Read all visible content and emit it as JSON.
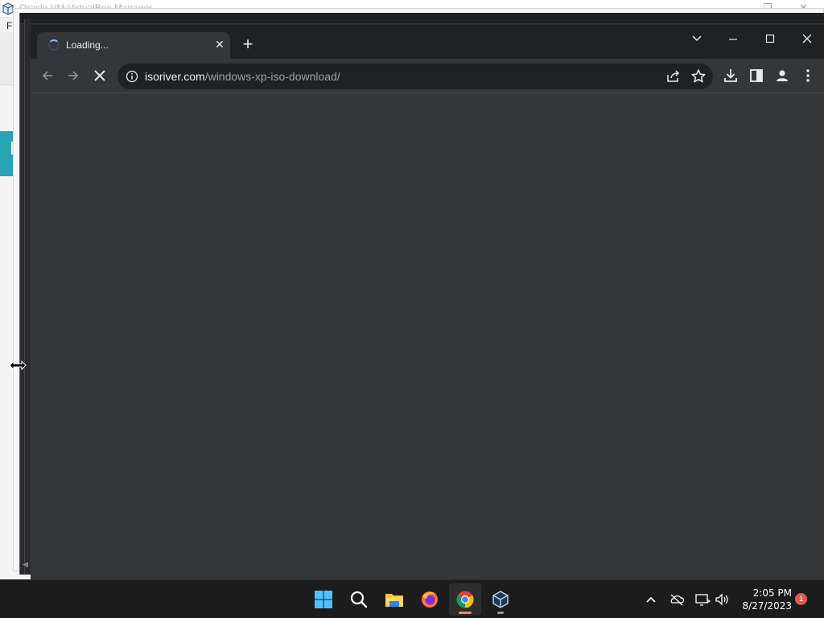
{
  "background_window": {
    "title": "Oracle VM VirtualBox Manager",
    "menu_first_letter": "Fi",
    "accent_color": "#2aa3b5"
  },
  "browser": {
    "tab": {
      "title": "Loading...",
      "status": "loading"
    },
    "new_tab_label": "+",
    "address": {
      "host": "isoriver.com",
      "path": "/windows-xp-iso-download/"
    },
    "content_bg": "#35363a",
    "icons": [
      "back-icon",
      "forward-icon",
      "stop-loading-icon",
      "site-info-icon",
      "share-icon",
      "bookmark-star-icon",
      "download-icon",
      "side-panel-icon",
      "profile-icon",
      "menu-icon",
      "tab-search-icon",
      "minimize-icon",
      "maximize-icon",
      "close-icon"
    ]
  },
  "taskbar": {
    "apps": [
      "start",
      "search",
      "file-explorer",
      "firefox",
      "chrome",
      "virtualbox"
    ],
    "active_app": "chrome",
    "clock": {
      "time": "2:05 PM",
      "date": "8/27/2023"
    },
    "notification_count": "1",
    "tray_icons": [
      "show-hidden-icons",
      "onedrive-offline-icon",
      "network-icon",
      "volume-icon"
    ]
  }
}
